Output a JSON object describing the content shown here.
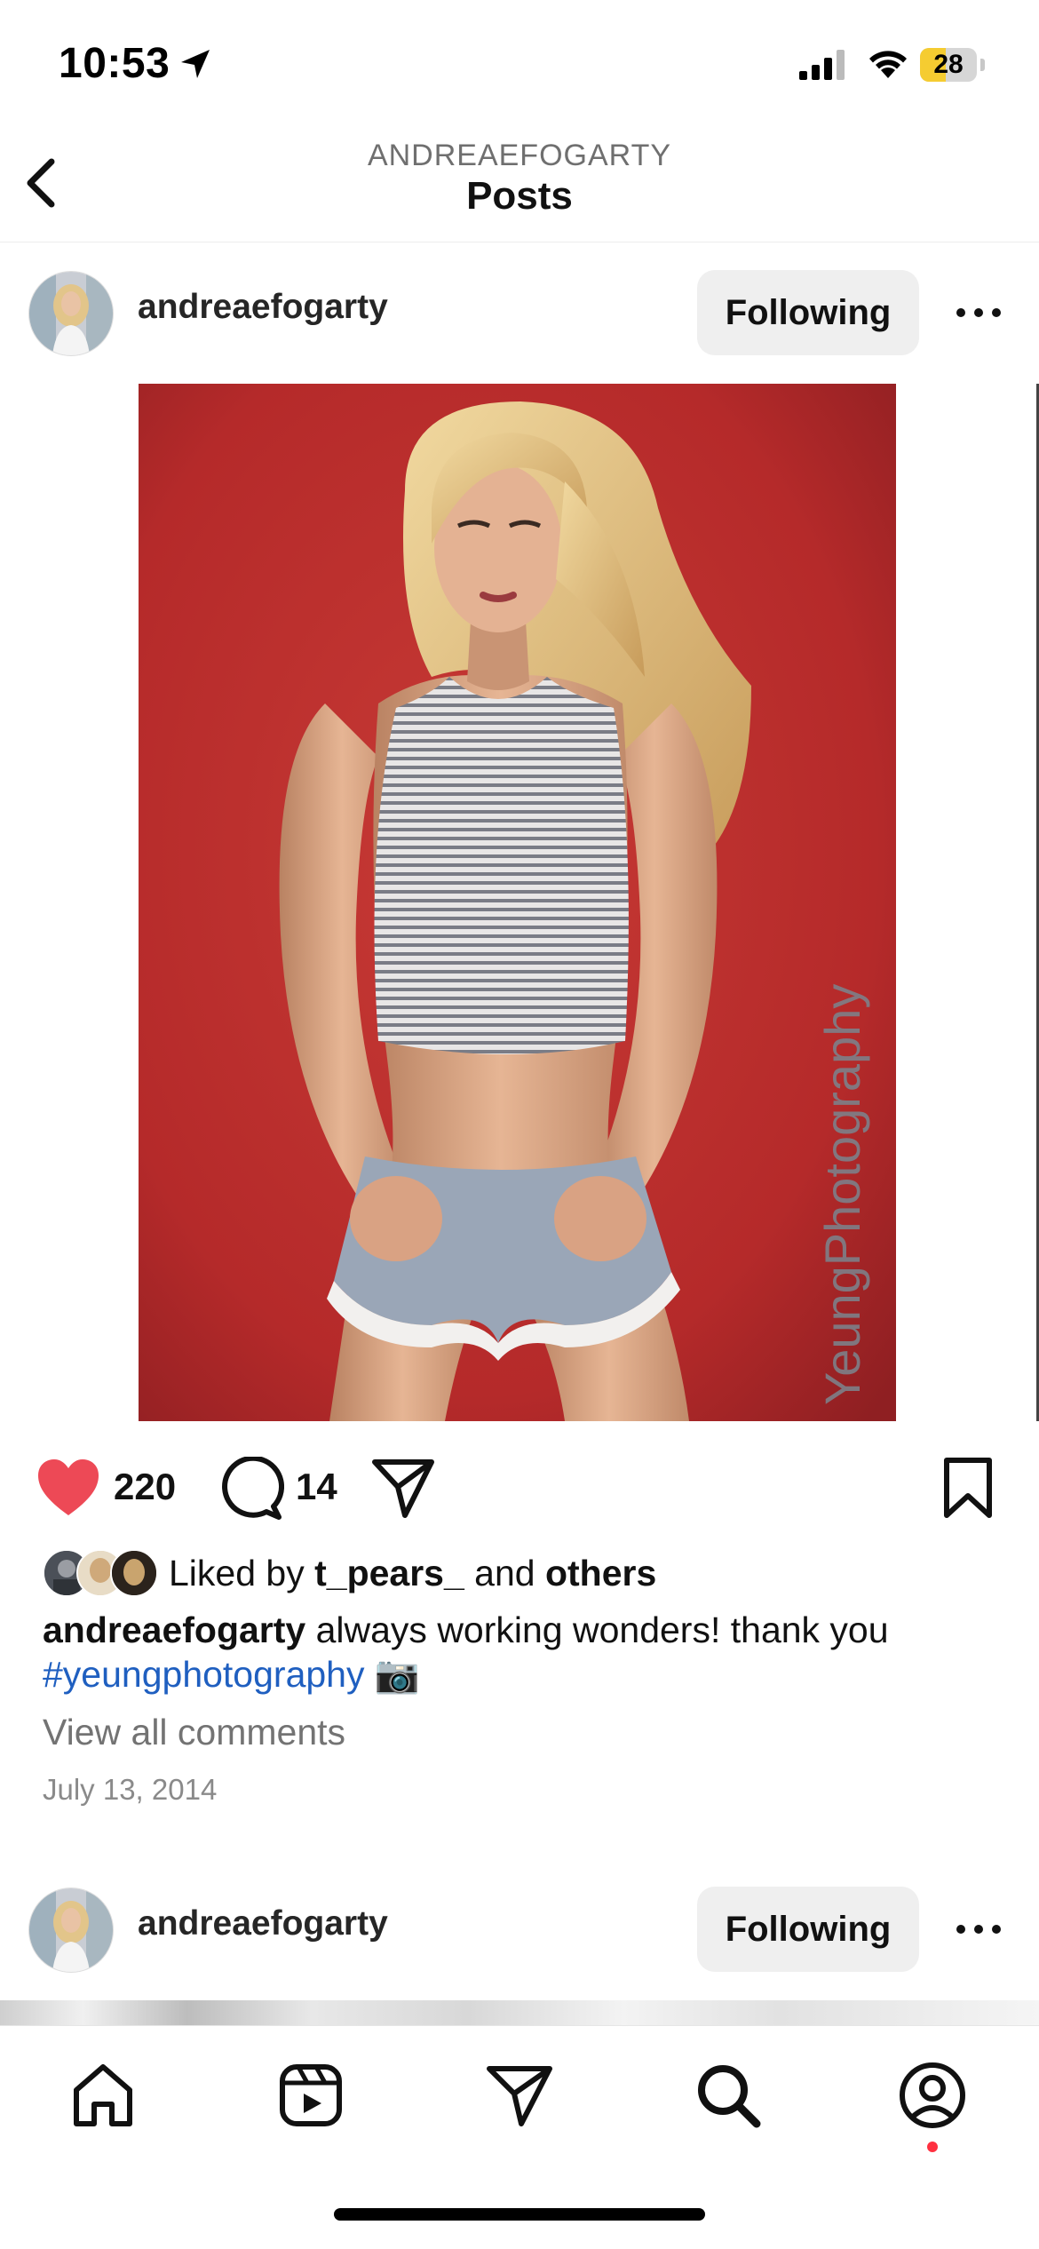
{
  "status_bar": {
    "time": "10:53",
    "battery": "28",
    "battery_level": 0.28,
    "icons": [
      "location-arrow-icon",
      "cellular-signal-icon",
      "wifi-icon",
      "battery-icon"
    ]
  },
  "nav": {
    "subtitle": "ANDREAEFOGARTY",
    "title": "Posts",
    "back_icon": "chevron-left-icon"
  },
  "post": {
    "username": "andreaefogarty",
    "follow_label": "Following",
    "photo_watermark": "YeungPhotography",
    "likes": "220",
    "comments": "14",
    "liked_by_prefix": "Liked by ",
    "liked_by_user": "t_pears_",
    "liked_by_mid": " and ",
    "liked_by_others": "others",
    "caption_user": "andreaefogarty",
    "caption_text": " always working wonders! thank you ",
    "caption_hashtag": "#yeungphotography",
    "caption_emoji": "📷",
    "view_comments": "View all comments",
    "date": "July 13, 2014"
  },
  "next_post": {
    "username": "andreaefogarty",
    "follow_label": "Following"
  },
  "tab_bar": {
    "items": [
      "home-icon",
      "reels-icon",
      "direct-message-icon",
      "search-icon",
      "profile-icon"
    ]
  },
  "colors": {
    "like_red": "#ed4956",
    "hashtag_blue": "#1f5fc0",
    "backdrop_red": "#b52a2a",
    "battery_yellow": "#f5cc31"
  }
}
